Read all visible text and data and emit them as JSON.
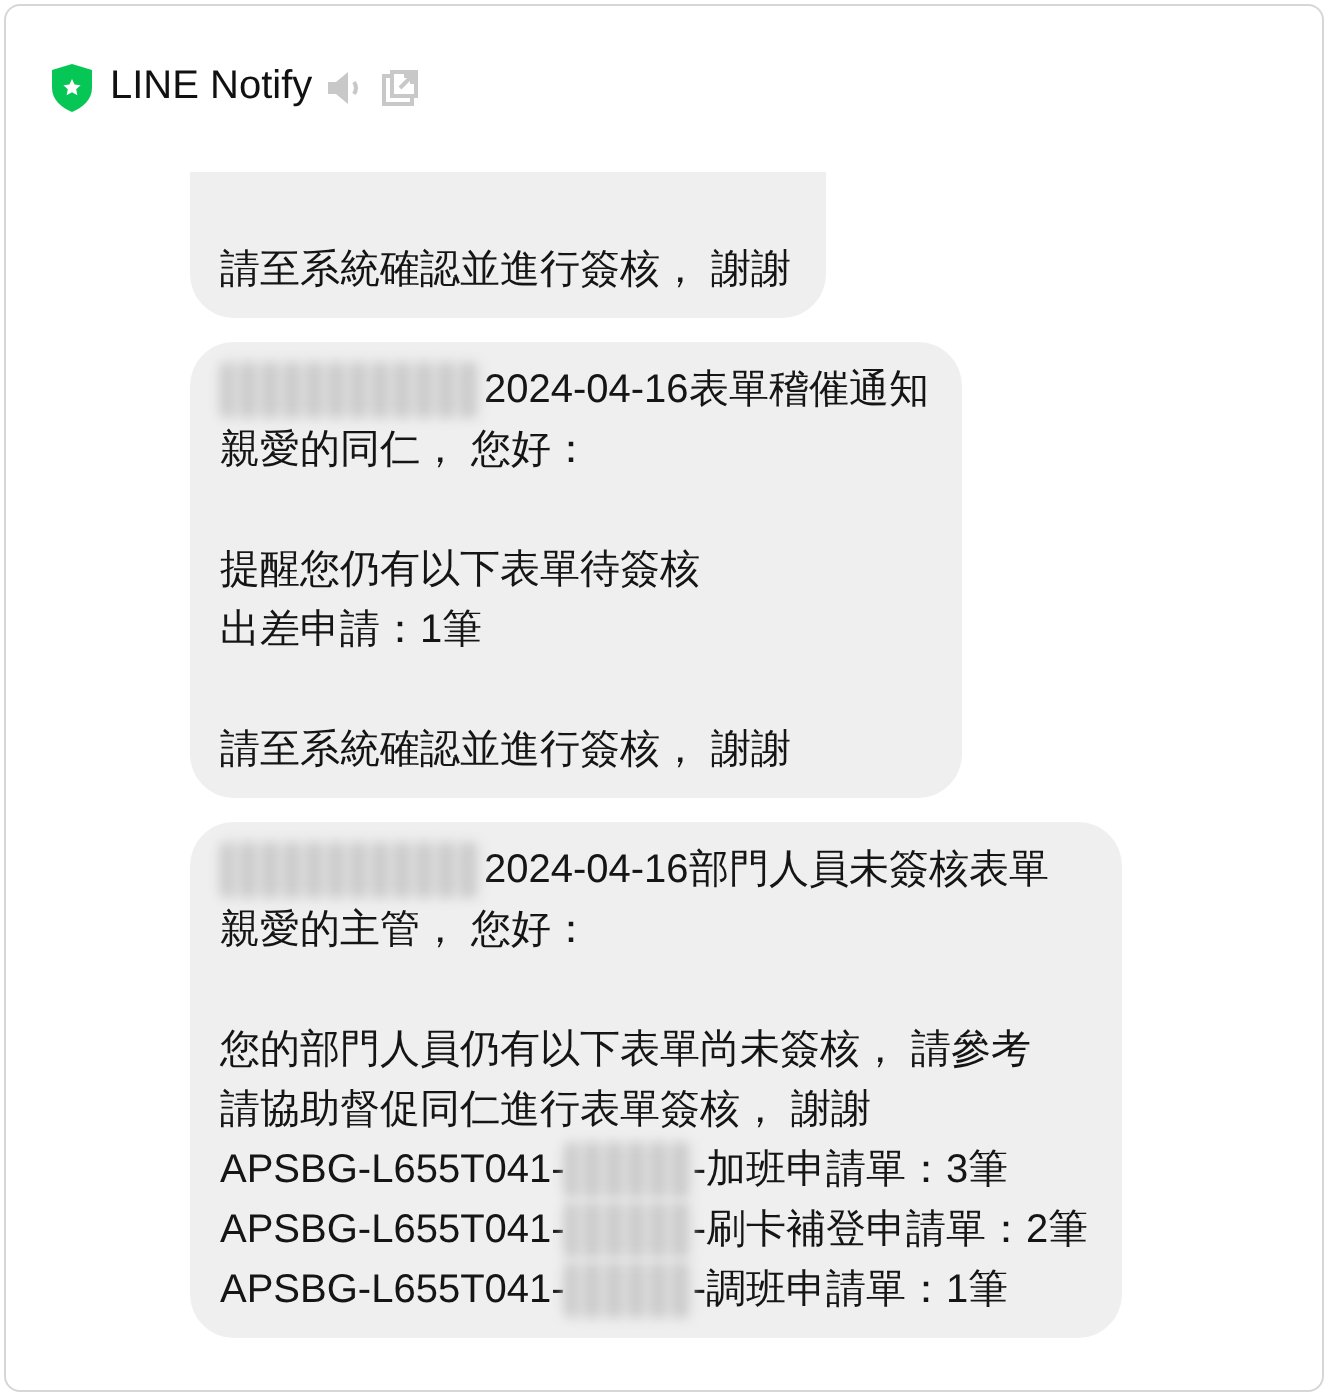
{
  "header": {
    "title": "LINE Notify"
  },
  "messages": [
    {
      "truncated_top": true,
      "paragraphs": [
        [
          {
            "parts": [
              {
                "kind": "text",
                "text": "請至系統確認並進行簽核， 謝謝"
              }
            ]
          }
        ]
      ]
    },
    {
      "truncated_top": false,
      "paragraphs": [
        [
          {
            "parts": [
              {
                "kind": "redacted_name"
              },
              {
                "kind": "text",
                "text": " 2024-04-16表單稽催通知"
              }
            ]
          },
          {
            "parts": [
              {
                "kind": "text",
                "text": "親愛的同仁， 您好："
              }
            ]
          }
        ],
        [
          {
            "parts": [
              {
                "kind": "text",
                "text": "提醒您仍有以下表單待簽核"
              }
            ]
          },
          {
            "parts": [
              {
                "kind": "text",
                "text": "出差申請：1筆"
              }
            ]
          }
        ],
        [
          {
            "parts": [
              {
                "kind": "text",
                "text": "請至系統確認並進行簽核， 謝謝"
              }
            ]
          }
        ]
      ]
    },
    {
      "truncated_top": false,
      "paragraphs": [
        [
          {
            "parts": [
              {
                "kind": "redacted_name"
              },
              {
                "kind": "text",
                "text": "2024-04-16部門人員未簽核表單"
              }
            ]
          },
          {
            "parts": [
              {
                "kind": "text",
                "text": "親愛的主管， 您好："
              }
            ]
          }
        ],
        [
          {
            "parts": [
              {
                "kind": "text",
                "text": "您的部門人員仍有以下表單尚未簽核， 請參考"
              }
            ]
          },
          {
            "parts": [
              {
                "kind": "text",
                "text": "請協助督促同仁進行表單簽核， 謝謝"
              }
            ]
          },
          {
            "parts": [
              {
                "kind": "text",
                "text": "APSBG-L655T041-"
              },
              {
                "kind": "redacted_id"
              },
              {
                "kind": "text",
                "text": "-加班申請單：3筆"
              }
            ]
          },
          {
            "parts": [
              {
                "kind": "text",
                "text": "APSBG-L655T041-"
              },
              {
                "kind": "redacted_id"
              },
              {
                "kind": "text",
                "text": "-刷卡補登申請單：2筆"
              }
            ]
          },
          {
            "parts": [
              {
                "kind": "text",
                "text": "APSBG-L655T041-"
              },
              {
                "kind": "redacted_id"
              },
              {
                "kind": "text",
                "text": "-調班申請單：1筆"
              }
            ]
          }
        ]
      ]
    }
  ]
}
